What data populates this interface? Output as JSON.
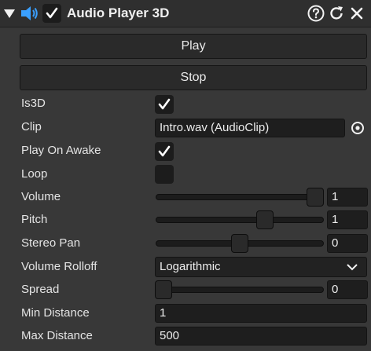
{
  "header": {
    "title": "Audio Player 3D",
    "enabled": true,
    "icons": [
      "fold-arrow-icon",
      "speaker-icon",
      "checkbox-icon",
      "help-icon",
      "reset-icon",
      "close-icon"
    ]
  },
  "buttons": {
    "play_label": "Play",
    "stop_label": "Stop"
  },
  "properties": {
    "is3d": {
      "label": "Is3D",
      "checked": true
    },
    "clip": {
      "label": "Clip",
      "value": "Intro.wav (AudioClip)"
    },
    "play_on_awake": {
      "label": "Play On Awake",
      "checked": true
    },
    "loop": {
      "label": "Loop",
      "checked": false
    },
    "volume": {
      "label": "Volume",
      "value": "1",
      "slider_fraction": 1.0
    },
    "pitch": {
      "label": "Pitch",
      "value": "1",
      "slider_fraction": 0.66
    },
    "stereo_pan": {
      "label": "Stereo Pan",
      "value": "0",
      "slider_fraction": 0.5
    },
    "volume_rolloff": {
      "label": "Volume Rolloff",
      "value": "Logarithmic"
    },
    "spread": {
      "label": "Spread",
      "value": "0",
      "slider_fraction": 0.0
    },
    "min_distance": {
      "label": "Min Distance",
      "value": "1"
    },
    "max_distance": {
      "label": "Max Distance",
      "value": "500"
    }
  },
  "colors": {
    "background": "#383838",
    "field": "#1e1e1e",
    "accent_speaker": "#3aa0ff"
  }
}
